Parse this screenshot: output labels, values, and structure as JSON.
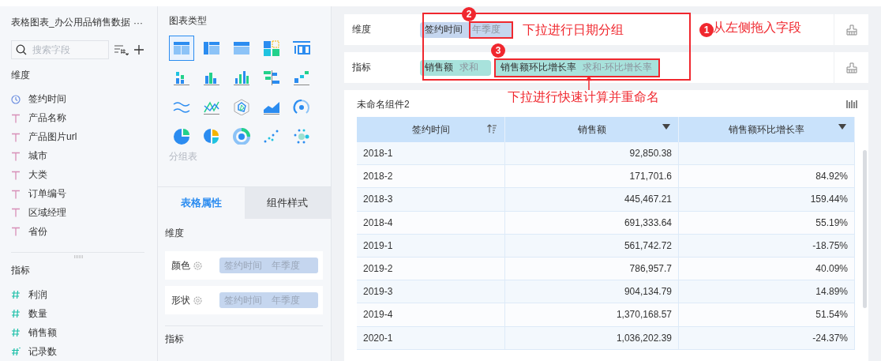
{
  "dataset": {
    "title": "表格图表_办公用品销售数据",
    "more": "···",
    "search_placeholder": "搜索字段"
  },
  "dimensions": {
    "heading": "维度",
    "fields": [
      {
        "kind": "time",
        "label": "签约时间"
      },
      {
        "kind": "text",
        "label": "产品名称"
      },
      {
        "kind": "text",
        "label": "产品图片url"
      },
      {
        "kind": "text",
        "label": "城市"
      },
      {
        "kind": "text",
        "label": "大类"
      },
      {
        "kind": "text",
        "label": "订单编号"
      },
      {
        "kind": "text",
        "label": "区域经理"
      },
      {
        "kind": "text",
        "label": "省份"
      }
    ]
  },
  "measures": {
    "heading": "指标",
    "fields": [
      {
        "kind": "number",
        "label": "利润"
      },
      {
        "kind": "number",
        "label": "数量"
      },
      {
        "kind": "number",
        "label": "销售额"
      },
      {
        "kind": "count",
        "label": "记录数"
      }
    ]
  },
  "chart_types": {
    "heading": "图表类型",
    "hover_label": "分组表",
    "items": [
      {
        "selected": true
      },
      {
        "selected": false
      },
      {
        "selected": false
      },
      {
        "selected": false
      },
      {
        "selected": false
      },
      {
        "selected": false
      },
      {
        "selected": false
      },
      {
        "selected": false
      },
      {
        "selected": false
      },
      {
        "selected": false
      },
      {
        "selected": false
      },
      {
        "selected": false
      },
      {
        "selected": false
      },
      {
        "selected": false
      },
      {
        "selected": false
      },
      {
        "selected": false
      },
      {
        "selected": false
      },
      {
        "selected": false
      },
      {
        "selected": false
      },
      {
        "selected": false
      }
    ]
  },
  "property_tabs": [
    {
      "label": "表格属性",
      "selected": true
    },
    {
      "label": "组件样式",
      "selected": false
    }
  ],
  "properties": {
    "heading": "维度",
    "rows": [
      {
        "label": "颜色",
        "field": "签约时间",
        "group": "年季度"
      },
      {
        "label": "形状",
        "field": "签约时间",
        "group": "年季度"
      }
    ],
    "footer_heading": "指标"
  },
  "shelves": [
    {
      "kind": "dimension",
      "label": "维度",
      "pills": [
        {
          "field": "签约时间",
          "aggregation": "年季度",
          "highlighted": true
        }
      ]
    },
    {
      "kind": "measure",
      "label": "指标",
      "pills": [
        {
          "field": "销售额",
          "aggregation": "求和",
          "highlighted": false
        },
        {
          "field": "销售额环比增长率",
          "aggregation": "求和-环比增长率",
          "highlighted": true
        }
      ]
    }
  ],
  "annotations": [
    {
      "badge": "2",
      "note": "下拉进行日期分组"
    },
    {
      "badge": "1",
      "note": "从左侧拖入字段"
    },
    {
      "badge": "3",
      "note": "下拉进行快速计算并重命名"
    }
  ],
  "widget": {
    "title": "未命名组件2"
  },
  "table": {
    "columns": [
      {
        "label": "签约时间",
        "kind": "sort"
      },
      {
        "label": "销售额",
        "kind": "menu"
      },
      {
        "label": "销售额环比增长率",
        "kind": "menu"
      }
    ],
    "rows": [
      [
        "2018-1",
        "92,850.38",
        ""
      ],
      [
        "2018-2",
        "171,701.6",
        "84.92%"
      ],
      [
        "2018-3",
        "445,467.21",
        "159.44%"
      ],
      [
        "2018-4",
        "691,333.64",
        "55.19%"
      ],
      [
        "2019-1",
        "561,742.72",
        "-18.75%"
      ],
      [
        "2019-2",
        "786,957.7",
        "40.09%"
      ],
      [
        "2019-3",
        "904,134.79",
        "14.89%"
      ],
      [
        "2019-4",
        "1,370,168.57",
        "51.54%"
      ],
      [
        "2020-1",
        "1,036,202.39",
        "-24.37%"
      ]
    ]
  }
}
